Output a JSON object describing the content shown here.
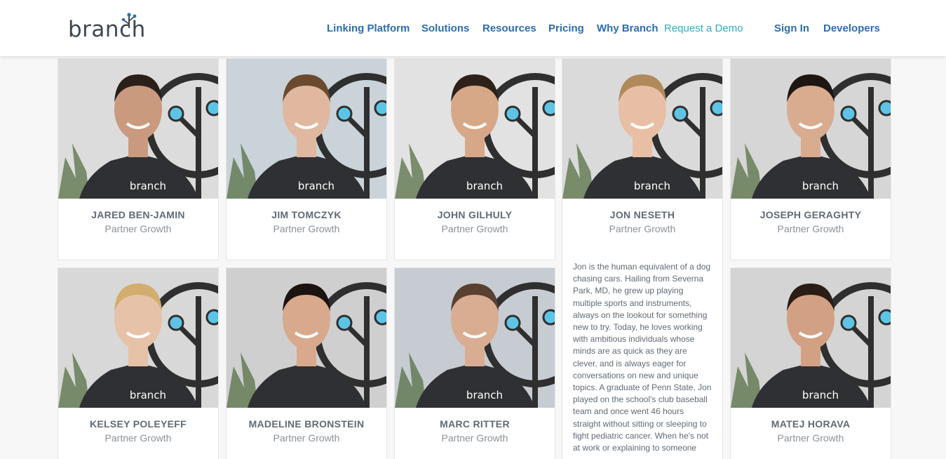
{
  "header": {
    "logo_text": "branch",
    "nav": [
      {
        "label": "Linking Platform"
      },
      {
        "label": "Solutions"
      },
      {
        "label": "Resources"
      },
      {
        "label": "Pricing"
      },
      {
        "label": "Why Branch"
      },
      {
        "label": "Request a Demo"
      },
      {
        "label": "Sign In"
      },
      {
        "label": "Developers"
      }
    ]
  },
  "team": [
    {
      "name": "JARED BEN-JAMIN",
      "role": "Partner Growth",
      "shirt": "branch"
    },
    {
      "name": "JIM TOMCZYK",
      "role": "Partner Growth",
      "shirt": "branch"
    },
    {
      "name": "JOHN GILHULY",
      "role": "Partner Growth",
      "shirt": "branch"
    },
    {
      "name": "JON NESETH",
      "role": "Partner Growth",
      "shirt": "branch",
      "bio": "Jon is the human equivalent of a dog chasing cars. Hailing from Severna Park, MD, he grew up playing multiple sports and instruments, always on the lookout for something new to try. Today, he loves working with ambitious individuals whose minds are as quick as they are clever, and is always eager for conversations on new and unique topics. A graduate of Penn State, Jon played on the school's club baseball team and once went 46 hours straight without sitting or sleeping to fight pediatric cancer. When he's not at work or explaining to someone"
    },
    {
      "name": "JOSEPH GERAGHTY",
      "role": "Partner Growth",
      "shirt": "branch"
    },
    {
      "name": "KELSEY POLEYEFF",
      "role": "Partner Growth",
      "shirt": "branch"
    },
    {
      "name": "MADELINE BRONSTEIN",
      "role": "Partner Growth",
      "shirt": ""
    },
    {
      "name": "MARC RITTER",
      "role": "Partner Growth",
      "shirt": "branch"
    },
    {
      "name": "MATEJ HORAVA",
      "role": "Partner Growth",
      "shirt": "branch"
    }
  ],
  "colors": {
    "nav_link": "#2d6db0",
    "demo_link": "#3aa6c9",
    "logo": "#3d4750",
    "accent_blue": "#5ec4e6",
    "shirt": "#2e3033"
  }
}
